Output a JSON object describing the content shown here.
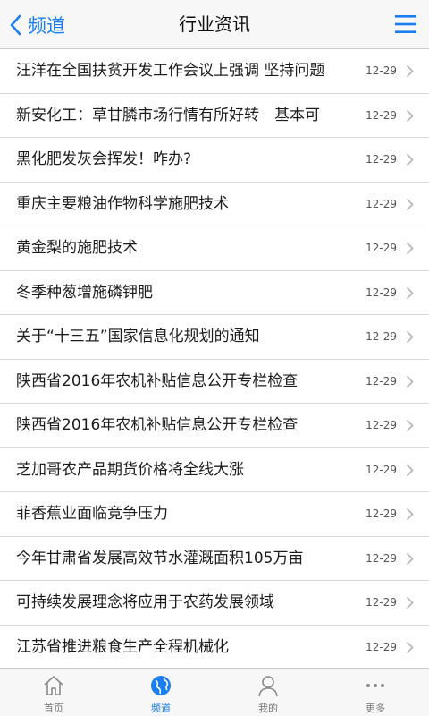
{
  "navbar": {
    "back_label": "频道",
    "title": "行业资讯",
    "back_icon": "chevron-left-icon",
    "menu_icon": "hamburger-menu-icon"
  },
  "colors": {
    "accent": "#1a7ef0"
  },
  "news": [
    {
      "title": "汪洋在全国扶贫开发工作会议上强调 坚持问题",
      "date": "12-29"
    },
    {
      "title": "新安化工：草甘膦市场行情有所好转　基本可",
      "date": "12-29"
    },
    {
      "title": "黑化肥发灰会挥发！咋办?",
      "date": "12-29"
    },
    {
      "title": "重庆主要粮油作物科学施肥技术",
      "date": "12-29"
    },
    {
      "title": "黄金梨的施肥技术",
      "date": "12-29"
    },
    {
      "title": "冬季种葱增施磷钾肥",
      "date": "12-29"
    },
    {
      "title": "关于“十三五”国家信息化规划的通知",
      "date": "12-29"
    },
    {
      "title": "陕西省2016年农机补贴信息公开专栏检查",
      "date": "12-29"
    },
    {
      "title": "陕西省2016年农机补贴信息公开专栏检查",
      "date": "12-29"
    },
    {
      "title": "芝加哥农产品期货价格将全线大涨",
      "date": "12-29"
    },
    {
      "title": "菲香蕉业面临竞争压力",
      "date": "12-29"
    },
    {
      "title": "今年甘肃省发展高效节水灌溉面积105万亩",
      "date": "12-29"
    },
    {
      "title": "可持续发展理念将应用于农药发展领域",
      "date": "12-29"
    },
    {
      "title": "江苏省推进粮食生产全程机械化",
      "date": "12-29"
    }
  ],
  "tabbar": {
    "tabs": [
      {
        "label": "首页",
        "icon": "home-icon",
        "active": false
      },
      {
        "label": "频道",
        "icon": "globe-icon",
        "active": true
      },
      {
        "label": "我的",
        "icon": "person-icon",
        "active": false
      },
      {
        "label": "更多",
        "icon": "more-dots-icon",
        "active": false
      }
    ]
  }
}
